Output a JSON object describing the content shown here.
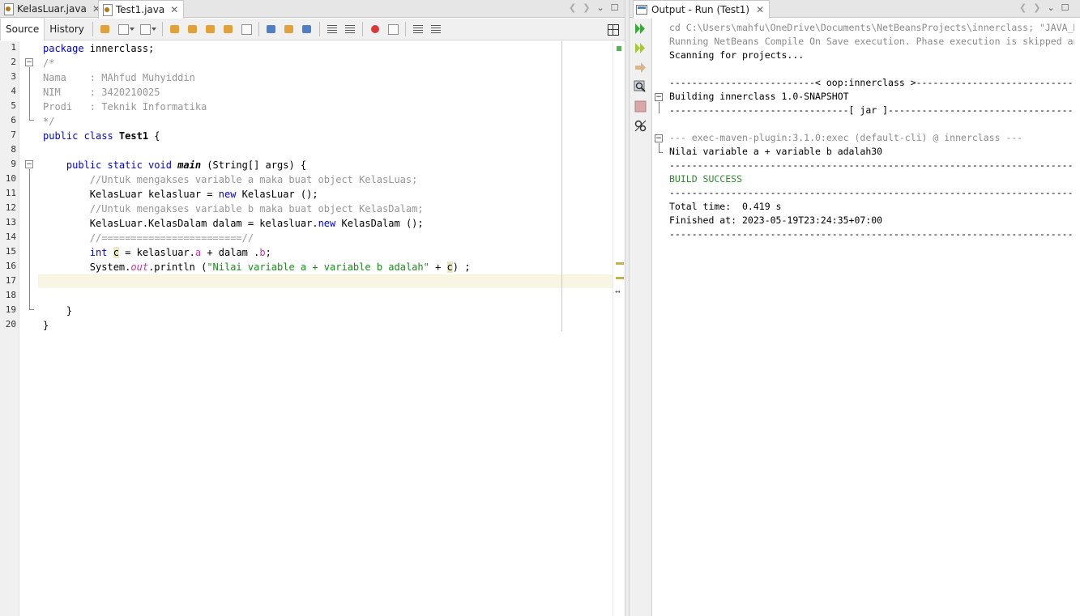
{
  "editor": {
    "tabs": [
      {
        "label": "KelasLuar.java",
        "active": false
      },
      {
        "label": "Test1.java",
        "active": true
      }
    ],
    "toolbar": {
      "source_label": "Source",
      "history_label": "History"
    },
    "line_numbers": [
      "1",
      "2",
      "3",
      "4",
      "5",
      "6",
      "7",
      "8",
      "9",
      "10",
      "11",
      "12",
      "13",
      "14",
      "15",
      "16",
      "17",
      "18",
      "19",
      "20"
    ],
    "code": {
      "l1_kw": "package",
      "l1_rest": " innerclass;",
      "l2": "/*",
      "l3": "Nama    : MAhfud Muhyiddin",
      "l4": "NIM     : 3420210025",
      "l5": "Prodi   : Teknik Informatika",
      "l6": "*/",
      "l7_kw": "public class",
      "l7_name": " Test1",
      "l7_rest": " {",
      "l9_kw": "    public static void",
      "l9_name": " main",
      "l9_rest": " (String[] args) {",
      "l10": "        //Untuk mengakses variable a maka buat object KelasLuas;",
      "l11_a": "        KelasLuar kelasluar = ",
      "l11_kw": "new",
      "l11_b": " KelasLuar ();",
      "l12": "        //Untuk mengakses variable b maka buat object KelasDalam;",
      "l13_a": "        KelasLuar.KelasDalam dalam = kelasluar.",
      "l13_kw": "new",
      "l13_b": " KelasDalam ();",
      "l14": "        //========================//",
      "l15_kw": "        int",
      "l15_var": "c",
      "l15_a": " = kelasluar.",
      "l15_f1": "a",
      "l15_b": " + dalam .",
      "l15_f2": "b",
      "l15_c": ";",
      "l16_a": "        System.",
      "l16_out": "out",
      "l16_b": ".println (",
      "l16_str": "\"Nilai variable a + variable b adalah\"",
      "l16_c": " + ",
      "l16_var": "c",
      "l16_d": ") ;",
      "l19": "    }",
      "l20": "}"
    }
  },
  "output": {
    "tab_label": "Output - Run (Test1)",
    "lines": {
      "o1": "cd C:\\Users\\mahfu\\OneDrive\\Documents\\NetBeansProjects\\innerclass; \"JAVA_HOME=C:\\Program Files\\Java",
      "o2": "Running NetBeans Compile On Save execution. Phase execution is skipped and output directories of",
      "o3": "Scanning for projects...",
      "o5": "--------------------------< oop:innerclass >---------------------------------------------------",
      "o6": "Building innerclass 1.0-SNAPSHOT",
      "o7": "--------------------------------[ jar ]--------------------------------------------------------",
      "o9": "--- exec-maven-plugin:3.1.0:exec (default-cli) @ innerclass ---",
      "o10": "Nilai variable a + variable b adalah30",
      "o11": "-----------------------------------------------------------------------------------------------",
      "o12": "BUILD SUCCESS",
      "o13": "-----------------------------------------------------------------------------------------------",
      "o14": "Total time:  0.419 s",
      "o15": "Finished at: 2023-05-19T23:24:35+07:00",
      "o16": "-----------------------------------------------------------------------------------------------"
    }
  },
  "colors": {
    "keyword": "#0000e6",
    "comment": "#969696",
    "string": "#ce7b00",
    "build_success": "#2e8b2e"
  }
}
